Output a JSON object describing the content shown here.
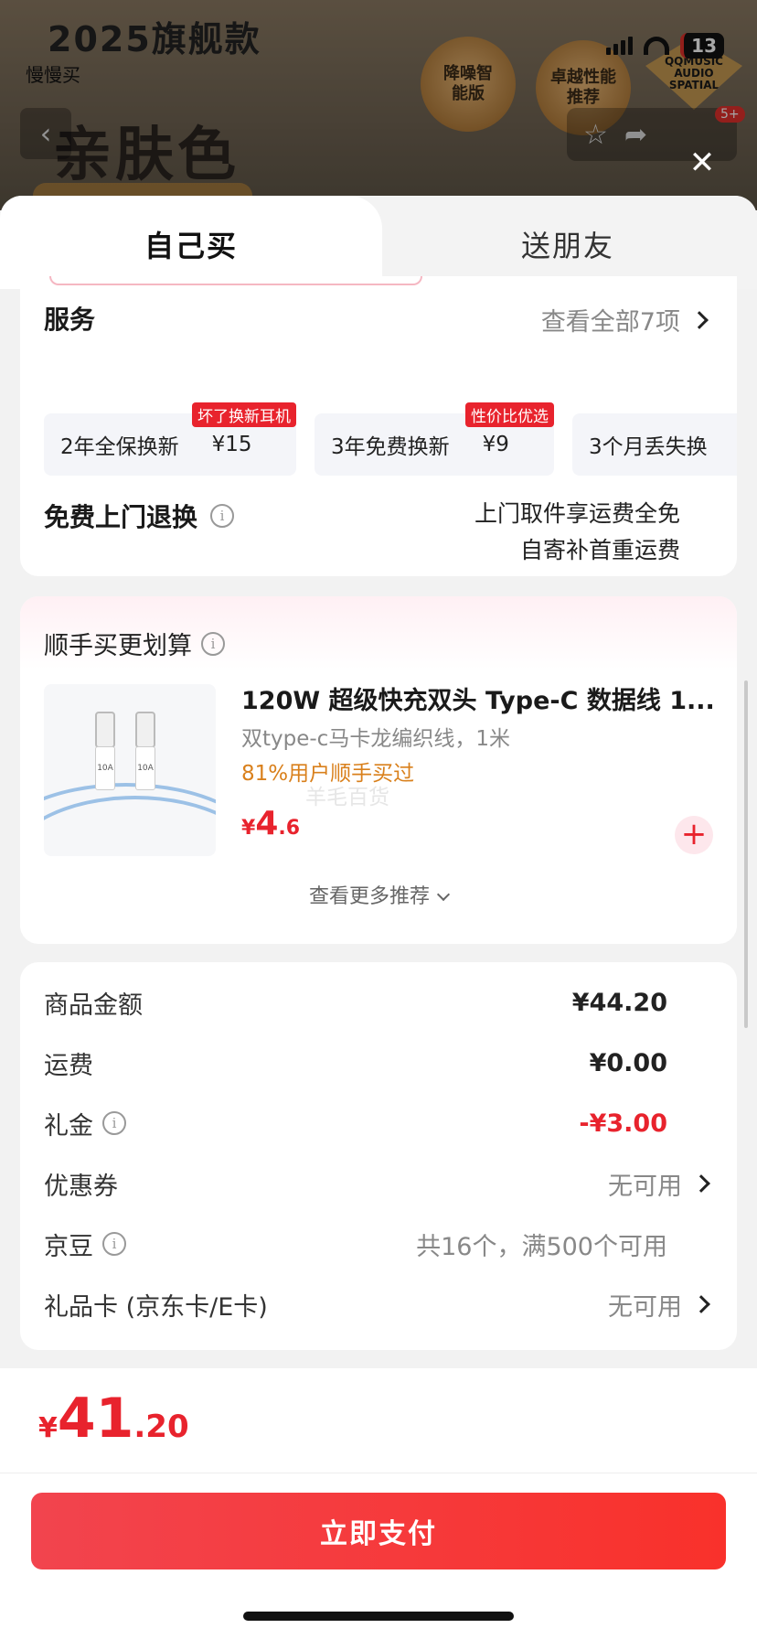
{
  "background": {
    "title": "2025旗舰款",
    "subtitle": "慢慢买",
    "hero": "亲肤色",
    "medal_left": "降噪智能版",
    "medal_right": "卓越性能推荐",
    "brand_badge": "QQMUSIC AUDIO SPATIAL",
    "cart_badge": "5+"
  },
  "status": {
    "battery": "13"
  },
  "tabs": [
    {
      "label": "自己买"
    },
    {
      "label": "送朋友"
    }
  ],
  "services": {
    "title": "服务",
    "view_all": "查看全部7项",
    "chips": [
      {
        "name": "2年全保换新",
        "price": "¥15",
        "tag": "坏了换新耳机"
      },
      {
        "name": "3年免费换新",
        "price": "¥9",
        "tag": "性价比优选"
      },
      {
        "name": "3个月丢失换",
        "price": "",
        "tag": ""
      }
    ],
    "return_title": "免费上门退换",
    "return_line1": "上门取件享运费全免",
    "return_line2": "自寄补首重运费"
  },
  "recommend": {
    "title": "顺手买更划算",
    "product_name": "120W 超级快充双头 Type-C 数据线 1...",
    "product_desc": "双type-c马卡龙编织线，1米",
    "hint": "81%用户顺手买过",
    "watermark": "羊毛百货",
    "price_currency": "¥",
    "price_int": "4",
    "price_dec": ".6",
    "plug_label": "10A",
    "more": "查看更多推荐"
  },
  "summary": {
    "rows": [
      {
        "label": "商品金额",
        "value": "¥44.20"
      },
      {
        "label": "运费",
        "value": "¥0.00"
      },
      {
        "label": "礼金",
        "value": "-¥3.00"
      },
      {
        "label": "优惠券",
        "value": "无可用"
      },
      {
        "label": "京豆",
        "value": "共16个，满500个可用"
      },
      {
        "label": "礼品卡 (京东卡/E卡)",
        "value": "无可用"
      }
    ]
  },
  "footer": {
    "total_currency": "¥",
    "total_int": "41",
    "total_dec": ".20",
    "pay_label": "立即支付"
  },
  "colors": {
    "accent": "#e8232d",
    "hint": "#d9801c"
  }
}
